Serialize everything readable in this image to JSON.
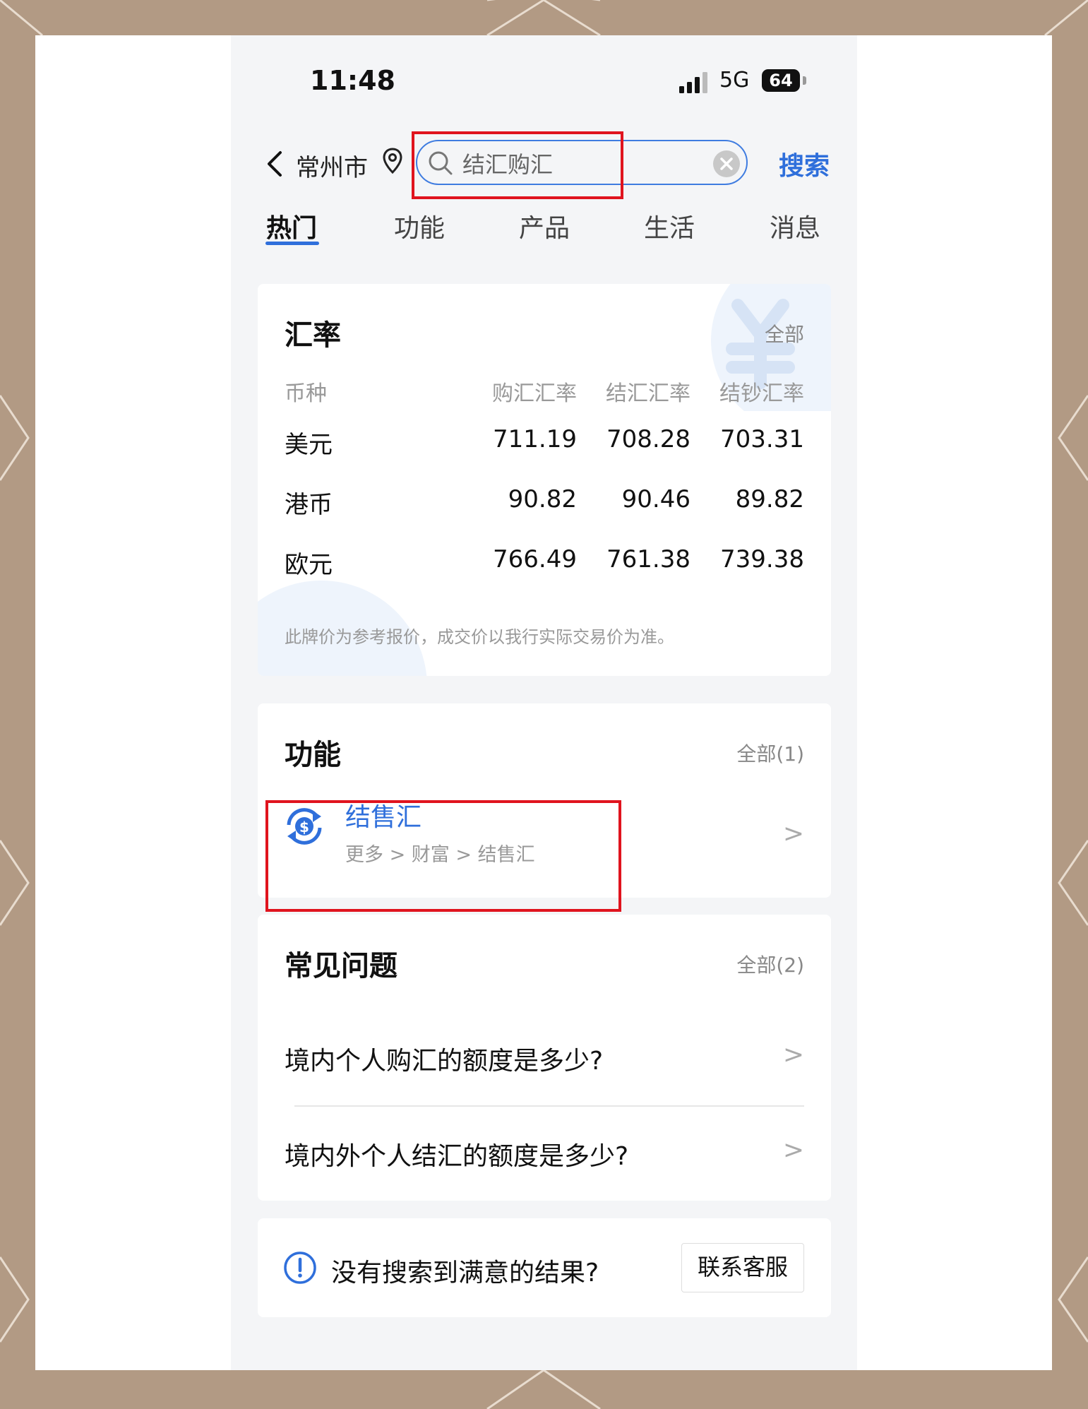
{
  "status": {
    "time": "11:48",
    "network": "5G",
    "battery": "64"
  },
  "header": {
    "city": "常州市",
    "search_value": "结汇购汇",
    "search_button": "搜索"
  },
  "tabs": [
    {
      "label": "热门",
      "active": true
    },
    {
      "label": "功能"
    },
    {
      "label": "产品"
    },
    {
      "label": "生活"
    },
    {
      "label": "消息"
    }
  ],
  "rates": {
    "title": "汇率",
    "more": "全部",
    "columns": [
      "币种",
      "购汇汇率",
      "结汇汇率",
      "结钞汇率"
    ],
    "rows": [
      [
        "美元",
        "711.19",
        "708.28",
        "703.31"
      ],
      [
        "港币",
        "90.82",
        "90.46",
        "89.82"
      ],
      [
        "欧元",
        "766.49",
        "761.38",
        "739.38"
      ]
    ],
    "note": "此牌价为参考报价，成交价以我行实际交易价为准。"
  },
  "functions": {
    "title": "功能",
    "more": "全部(1)",
    "items": [
      {
        "name": "结售汇",
        "path": "更多 > 财富 > 结售汇",
        "icon": "currency-exchange-icon"
      }
    ]
  },
  "faq": {
    "title": "常见问题",
    "more": "全部(2)",
    "items": [
      {
        "question": "境内个人购汇的额度是多少?"
      },
      {
        "question": "境内外个人结汇的额度是多少?"
      }
    ]
  },
  "help": {
    "text": "没有搜索到满意的结果?",
    "button": "联系客服"
  },
  "colors": {
    "accent": "#2f6fdb",
    "highlight": "#e0141e",
    "frame": "#b29a84"
  }
}
